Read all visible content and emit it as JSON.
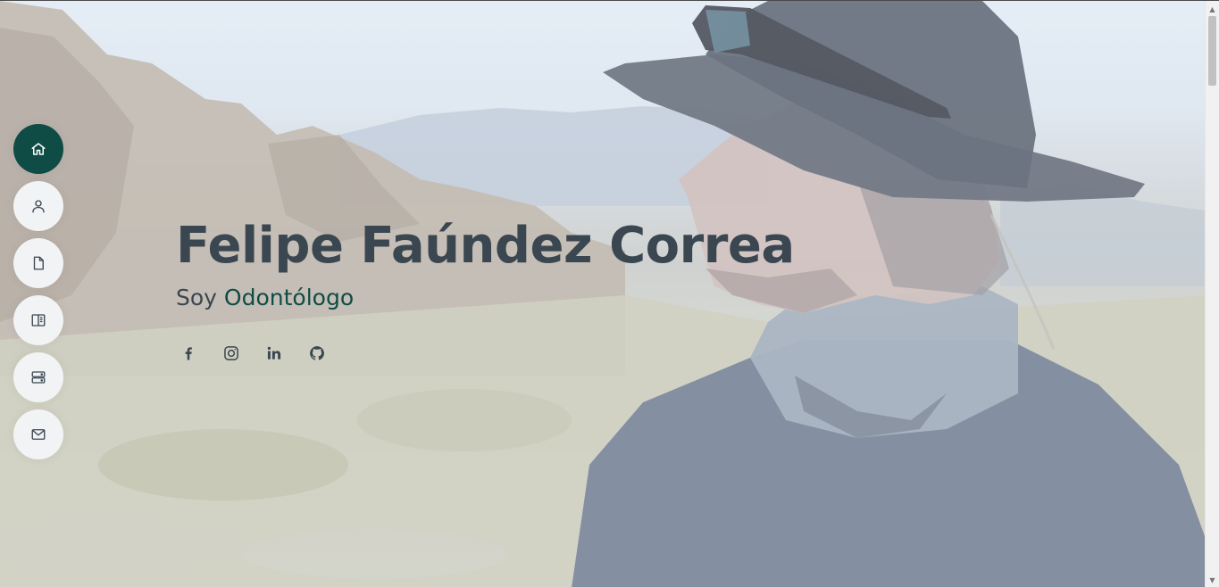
{
  "hero": {
    "name": "Felipe Faúndez Correa",
    "subtitle_prefix": "Soy",
    "subtitle_role": "Odontólogo",
    "accent_color": "#0f4c45",
    "text_color": "#3a4650"
  },
  "side_nav": {
    "items": [
      {
        "icon": "home-icon",
        "active": true
      },
      {
        "icon": "user-icon",
        "active": false
      },
      {
        "icon": "file-icon",
        "active": false
      },
      {
        "icon": "book-icon",
        "active": false
      },
      {
        "icon": "server-icon",
        "active": false
      },
      {
        "icon": "envelope-icon",
        "active": false
      }
    ]
  },
  "social": [
    {
      "icon": "facebook-icon"
    },
    {
      "icon": "instagram-icon"
    },
    {
      "icon": "linkedin-icon"
    },
    {
      "icon": "github-icon"
    }
  ]
}
